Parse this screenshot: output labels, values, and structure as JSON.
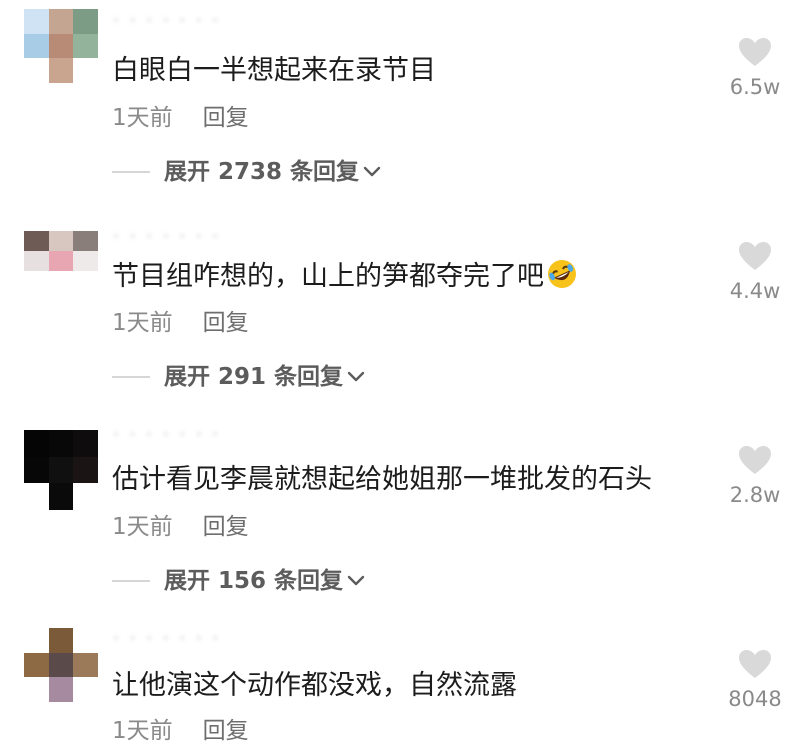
{
  "comments": [
    {
      "username": "· · · · · · ·",
      "text": "白眼白一半想起来在录节目",
      "time": "1天前",
      "reply_label": "回复",
      "expand_label": "展开 2738 条回复",
      "likes": "6.5w",
      "has_emoji": false
    },
    {
      "username": "· · · · · · ·",
      "text": "节目组咋想的，山上的笋都夺完了吧",
      "time": "1天前",
      "reply_label": "回复",
      "expand_label": "展开 291 条回复",
      "likes": "4.4w",
      "has_emoji": true,
      "emoji_icon": "rolling-on-floor-laughing-icon"
    },
    {
      "username": "· · · · · · ·",
      "text": "估计看见李晨就想起给她姐那一堆批发的石头",
      "time": "1天前",
      "reply_label": "回复",
      "expand_label": "展开 156 条回复",
      "likes": "2.8w",
      "has_emoji": false
    },
    {
      "username": "· · · · · · ·",
      "text": "让他演这个动作都没戏，自然流露",
      "time": "1天前",
      "reply_label": "回复",
      "likes": "8048",
      "has_emoji": false
    }
  ],
  "colors": {
    "text": "#1c1c1c",
    "meta": "#8a8a8a",
    "heart": "#d9d9d9"
  },
  "icons": {
    "like": "heart-icon",
    "expand": "chevron-down-icon"
  }
}
